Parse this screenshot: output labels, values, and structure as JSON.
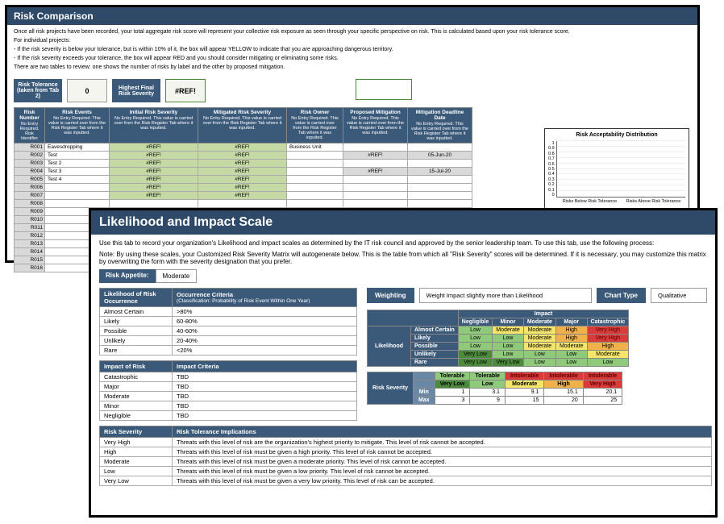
{
  "panel1": {
    "title": "Risk Comparison",
    "intro1": "Once all risk projects have been recorded, your total aggregate risk score will represent your collective risk exposure as seen through your specific perspective on risk. This is calculated based upon your risk tolerance score.",
    "intro2": "For individual projects:",
    "intro3": "- If the risk severity is below your tolerance, but is within 10% of it, the box will appear YELLOW to indicate that you are approaching dangerous territory.",
    "intro4": "- If the risk severity exceeds your tolerance, the box will appear RED and you should consider mitigating or eliminating some risks.",
    "intro5": "There are two tables to review: one shows the number of risks by label and the other by proposed mitigation.",
    "tol_label": "Risk Tolerance",
    "tol_sub": "(taken from Tab 2)",
    "tol_value": "0",
    "hfs_label": "Highest Final Risk Severity",
    "hfs_value": "#REF!",
    "cols": {
      "c1": "Risk Number",
      "c1s": "No Entry Required. Risk Identifier",
      "c2": "Risk Events",
      "c2s": "No Entry Required. This value is carried over from the Risk Register Tab where it was inputted.",
      "c3": "Initial Risk Severity",
      "c3s": "No Entry Required. This value is carried over from the Risk Register Tab where it was inputted.",
      "c4": "Mitigated Risk Severity",
      "c4s": "No Entry Required. This value is carried over from the Risk Register Tab where it was inputted.",
      "c5": "Risk Owner",
      "c5s": "No Entry Required. This value is carried over from the Risk Register Tab where it was inputted.",
      "c6": "Proposed Mitigation",
      "c6s": "No Entry Required. This value is carried over from the Risk Register Tab where it was inputted.",
      "c7": "Mitigation Deadline Date",
      "c7s": "No Entry Required. This value is carried over from the Risk Register Tab where it was inputted."
    },
    "rows": [
      {
        "n": "R001",
        "e": "Eavesdropping",
        "i": "#REF!",
        "m": "#REF!",
        "o": "Business Unit",
        "p": "",
        "d": ""
      },
      {
        "n": "R002",
        "e": "Test",
        "i": "#REF!",
        "m": "#REF!",
        "o": "",
        "p": "#REF!",
        "d": "05-Jun-20"
      },
      {
        "n": "R003",
        "e": "Test 2",
        "i": "#REF!",
        "m": "#REF!",
        "o": "",
        "p": "",
        "d": ""
      },
      {
        "n": "R004",
        "e": "Test 3",
        "i": "#REF!",
        "m": "#REF!",
        "o": "",
        "p": "#REF!",
        "d": "15-Jul-20"
      },
      {
        "n": "R005",
        "e": "Test 4",
        "i": "#REF!",
        "m": "#REF!",
        "o": "",
        "p": "",
        "d": ""
      },
      {
        "n": "R006",
        "e": "",
        "i": "#REF!",
        "m": "#REF!",
        "o": "",
        "p": "",
        "d": ""
      },
      {
        "n": "R007",
        "e": "",
        "i": "#REF!",
        "m": "#REF!",
        "o": "",
        "p": "",
        "d": ""
      },
      {
        "n": "R008",
        "e": "",
        "i": "",
        "m": "",
        "o": "",
        "p": "",
        "d": ""
      },
      {
        "n": "R009",
        "e": "",
        "i": "",
        "m": "",
        "o": "",
        "p": "",
        "d": ""
      },
      {
        "n": "R010",
        "e": "",
        "i": "",
        "m": "",
        "o": "",
        "p": "",
        "d": ""
      },
      {
        "n": "R011",
        "e": "",
        "i": "",
        "m": "",
        "o": "",
        "p": "",
        "d": ""
      },
      {
        "n": "R012",
        "e": "",
        "i": "",
        "m": "",
        "o": "",
        "p": "",
        "d": ""
      },
      {
        "n": "R013",
        "e": "",
        "i": "",
        "m": "",
        "o": "",
        "p": "",
        "d": ""
      },
      {
        "n": "R014",
        "e": "",
        "i": "",
        "m": "",
        "o": "",
        "p": "",
        "d": ""
      },
      {
        "n": "R015",
        "e": "",
        "i": "",
        "m": "",
        "o": "",
        "p": "",
        "d": ""
      },
      {
        "n": "R016",
        "e": "",
        "i": "",
        "m": "",
        "o": "",
        "p": "",
        "d": ""
      }
    ]
  },
  "chart_data": {
    "type": "bar",
    "title": "Risk Acceptability Distribution",
    "categories": [
      "Risks Below Risk Tolerance",
      "Risks Above Risk Tolerance"
    ],
    "values": [
      0,
      0
    ],
    "ylim": [
      0,
      1
    ],
    "yticks": [
      "0",
      "0.1",
      "0.2",
      "0.3",
      "0.4",
      "0.5",
      "0.6",
      "0.7",
      "0.8",
      "0.9",
      "1"
    ]
  },
  "panel2": {
    "title": "Likelihood and Impact Scale",
    "p1": "Use this tab to record your organization's Likelihood and impact scales as determined by the IT risk council and approved by the senior leadership team. To use this tab, use the following process:",
    "p2": "Note: By using these scales, your Customized Risk Severity Matrix will autogenerate below. This is the table from which all \"Risk Severity\" scores will be determined. If it is necessary, you may customize this matrix by overwriting the form with the severity designation that you prefer.",
    "appetite_label": "Risk Appetite:",
    "appetite_value": "Moderate",
    "lik_h1": "Likelihood of Risk Occurrence",
    "lik_h2": "Occurrence Criteria",
    "lik_h2s": "(Classification: Probability of Risk Event Within One Year)",
    "lik_rows": [
      {
        "l": "Almost Certain",
        "c": ">80%"
      },
      {
        "l": "Likely",
        "c": "60-80%"
      },
      {
        "l": "Possible",
        "c": "40-60%"
      },
      {
        "l": "Unlikely",
        "c": "20-40%"
      },
      {
        "l": "Rare",
        "c": "<20%"
      }
    ],
    "imp_h1": "Impact of Risk",
    "imp_h2": "Impact Criteria",
    "imp_rows": [
      {
        "l": "Catastrophic",
        "c": "TBD"
      },
      {
        "l": "Major",
        "c": "TBD"
      },
      {
        "l": "Moderate",
        "c": "TBD"
      },
      {
        "l": "Minor",
        "c": "TBD"
      },
      {
        "l": "Negligible",
        "c": "TBD"
      }
    ],
    "weighting_label": "Weighting",
    "weighting_value": "Weight Impact slightly more than Likelihood",
    "charttype_label": "Chart Type",
    "charttype_value": "Qualitative",
    "matrix": {
      "impact_label": "Impact",
      "likelihood_label": "Likelihood",
      "impact_headers": [
        "Negligible",
        "Minor",
        "Moderate",
        "Major",
        "Catastrophic"
      ],
      "rows": [
        {
          "l": "Almost Certain",
          "v": [
            "Low",
            "Moderate",
            "Moderate",
            "High",
            "Very High"
          ],
          "c": [
            "c-l",
            "c-m",
            "c-m",
            "c-h",
            "c-vh"
          ]
        },
        {
          "l": "Likely",
          "v": [
            "Low",
            "Low",
            "Moderate",
            "High",
            "Very High"
          ],
          "c": [
            "c-l",
            "c-l",
            "c-m",
            "c-h",
            "c-vh"
          ]
        },
        {
          "l": "Possible",
          "v": [
            "Low",
            "Low",
            "Moderate",
            "Moderate",
            "High"
          ],
          "c": [
            "c-l",
            "c-l",
            "c-m",
            "c-m",
            "c-h"
          ]
        },
        {
          "l": "Unlikely",
          "v": [
            "Very Low",
            "Low",
            "Low",
            "Low",
            "Moderate"
          ],
          "c": [
            "c-vl",
            "c-l",
            "c-l",
            "c-l",
            "c-m"
          ]
        },
        {
          "l": "Rare",
          "v": [
            "Very Low",
            "Very Low",
            "Low",
            "Low",
            "Low"
          ],
          "c": [
            "c-vl",
            "c-vl",
            "c-l",
            "c-l",
            "c-l"
          ]
        }
      ]
    },
    "tolerance": {
      "label": "Risk Severity",
      "headers": [
        "Tolerable",
        "Tolerable",
        "Intolerable",
        "Intolerable",
        "Intolerable"
      ],
      "hclasses": [
        "c-l",
        "c-l",
        "c-vh",
        "c-vh",
        "c-vh"
      ],
      "sev": [
        "Very Low",
        "Low",
        "Moderate",
        "High",
        "Very High"
      ],
      "sevc": [
        "c-vl",
        "c-l",
        "c-m",
        "c-h",
        "c-vh"
      ],
      "min_label": "Min",
      "max_label": "Max",
      "min": [
        "1",
        "3.1",
        "9.1",
        "15.1",
        "20.1"
      ],
      "max": [
        "3",
        "9",
        "15",
        "20",
        "25"
      ]
    },
    "sev_h1": "Risk Severity",
    "sev_h2": "Risk Tolerance Implications",
    "sev_rows": [
      {
        "l": "Very High",
        "c": "Threats with this level of risk are the organization's highest priority to mitigate. This level of risk cannot be accepted."
      },
      {
        "l": "High",
        "c": "Threats with this level of risk must be given a high priority. This level of risk cannot be accepted."
      },
      {
        "l": "Moderate",
        "c": "Threats with this level of risk must be given a moderate priority. This level of risk cannot be accepted."
      },
      {
        "l": "Low",
        "c": "Threats with this level of risk must be given a low priority. This level of risk cannot be accepted."
      },
      {
        "l": "Very Low",
        "c": "Threats with this level of risk must be given a very low priority. This level of risk can be accepted."
      }
    ]
  }
}
